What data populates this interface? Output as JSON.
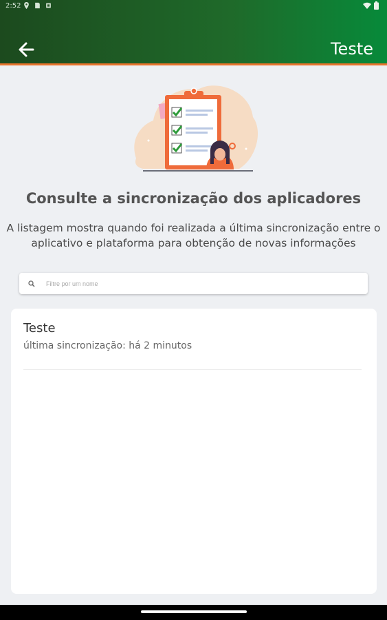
{
  "status_bar": {
    "time": "2:52",
    "icons": [
      "location-icon",
      "sim-card-icon",
      "app-notification-icon"
    ],
    "right_icons": [
      "wifi-icon",
      "battery-icon"
    ]
  },
  "app_bar": {
    "back_icon": "arrow-left-icon",
    "title": "Teste",
    "gradient_start": "#1c4a1e",
    "gradient_end": "#078a3a",
    "accent_border": "#e8742c"
  },
  "hero": {
    "icon": "clipboard-checklist-illustration"
  },
  "heading": "Consulte a sincronização dos aplicadores",
  "description_line1": "A listagem mostra quando foi realizada a última sincronização entre o",
  "description_line2": "aplicativo e plataforma para obtenção de novas informações",
  "search": {
    "icon": "search-icon",
    "placeholder": "Filtre por um nome",
    "value": ""
  },
  "list": {
    "items": [
      {
        "name": "Teste",
        "last_sync": "última sincronização: há 2 minutos"
      }
    ]
  }
}
